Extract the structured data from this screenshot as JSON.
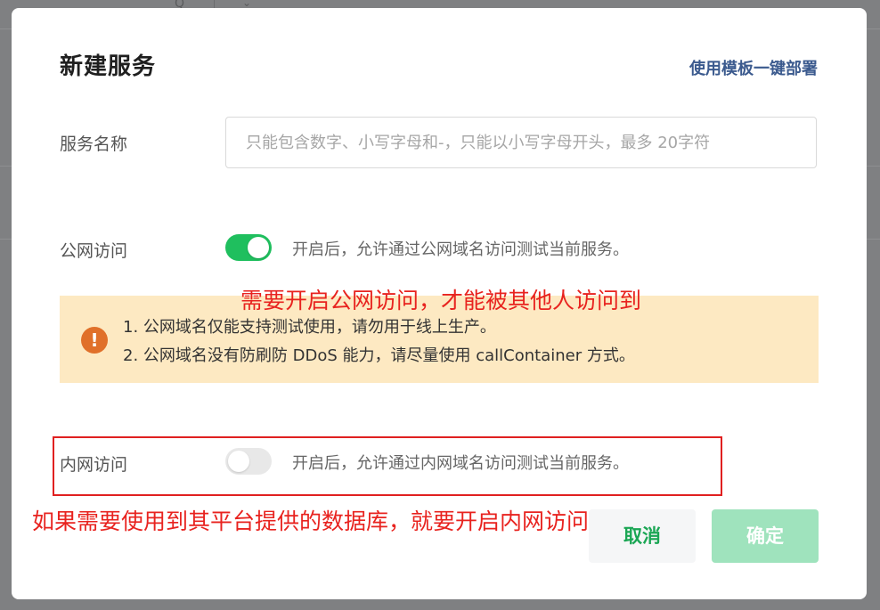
{
  "background": {
    "search_glyph": "Q",
    "close_glyph": "⌄"
  },
  "dialog": {
    "title": "新建服务",
    "template_link": "使用模板一键部署",
    "service_name": {
      "label": "服务名称",
      "placeholder": "只能包含数字、小写字母和-，只能以小写字母开头，最多 20字符",
      "value": ""
    },
    "public_access": {
      "label": "公网访问",
      "enabled": true,
      "description": "开启后，允许通过公网域名访问测试当前服务。"
    },
    "warning": {
      "icon": "exclamation-icon",
      "lines": [
        "1. 公网域名仅能支持测试使用，请勿用于线上生产。",
        "2. 公网域名没有防刷防 DDoS 能力，请尽量使用 callContainer 方式。"
      ]
    },
    "private_access": {
      "label": "内网访问",
      "enabled": false,
      "description": "开启后，允许通过内网域名访问测试当前服务。"
    },
    "buttons": {
      "cancel": "取消",
      "confirm": "确定"
    }
  },
  "annotations": {
    "public_note": "需要开启公网访问，才能被其他人访问到",
    "private_note": "如果需要使用到其平台提供的数据库，就要开启内网访问"
  },
  "colors": {
    "accent_green": "#1fbf5e",
    "link_blue": "#3b5a8e",
    "warning_bg": "#fde9c2",
    "warning_icon": "#e0702a",
    "annotation_red": "#e8231f"
  }
}
